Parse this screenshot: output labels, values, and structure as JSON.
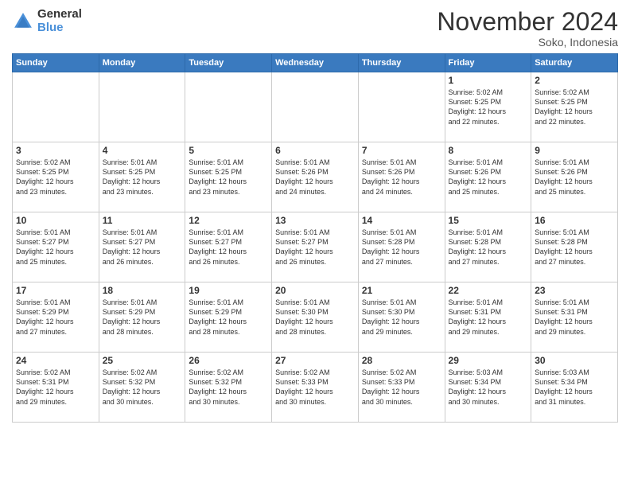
{
  "header": {
    "logo_general": "General",
    "logo_blue": "Blue",
    "month_title": "November 2024",
    "location": "Soko, Indonesia"
  },
  "weekdays": [
    "Sunday",
    "Monday",
    "Tuesday",
    "Wednesday",
    "Thursday",
    "Friday",
    "Saturday"
  ],
  "weeks": [
    [
      {
        "day": "",
        "info": ""
      },
      {
        "day": "",
        "info": ""
      },
      {
        "day": "",
        "info": ""
      },
      {
        "day": "",
        "info": ""
      },
      {
        "day": "",
        "info": ""
      },
      {
        "day": "1",
        "info": "Sunrise: 5:02 AM\nSunset: 5:25 PM\nDaylight: 12 hours\nand 22 minutes."
      },
      {
        "day": "2",
        "info": "Sunrise: 5:02 AM\nSunset: 5:25 PM\nDaylight: 12 hours\nand 22 minutes."
      }
    ],
    [
      {
        "day": "3",
        "info": "Sunrise: 5:02 AM\nSunset: 5:25 PM\nDaylight: 12 hours\nand 23 minutes."
      },
      {
        "day": "4",
        "info": "Sunrise: 5:01 AM\nSunset: 5:25 PM\nDaylight: 12 hours\nand 23 minutes."
      },
      {
        "day": "5",
        "info": "Sunrise: 5:01 AM\nSunset: 5:25 PM\nDaylight: 12 hours\nand 23 minutes."
      },
      {
        "day": "6",
        "info": "Sunrise: 5:01 AM\nSunset: 5:26 PM\nDaylight: 12 hours\nand 24 minutes."
      },
      {
        "day": "7",
        "info": "Sunrise: 5:01 AM\nSunset: 5:26 PM\nDaylight: 12 hours\nand 24 minutes."
      },
      {
        "day": "8",
        "info": "Sunrise: 5:01 AM\nSunset: 5:26 PM\nDaylight: 12 hours\nand 25 minutes."
      },
      {
        "day": "9",
        "info": "Sunrise: 5:01 AM\nSunset: 5:26 PM\nDaylight: 12 hours\nand 25 minutes."
      }
    ],
    [
      {
        "day": "10",
        "info": "Sunrise: 5:01 AM\nSunset: 5:27 PM\nDaylight: 12 hours\nand 25 minutes."
      },
      {
        "day": "11",
        "info": "Sunrise: 5:01 AM\nSunset: 5:27 PM\nDaylight: 12 hours\nand 26 minutes."
      },
      {
        "day": "12",
        "info": "Sunrise: 5:01 AM\nSunset: 5:27 PM\nDaylight: 12 hours\nand 26 minutes."
      },
      {
        "day": "13",
        "info": "Sunrise: 5:01 AM\nSunset: 5:27 PM\nDaylight: 12 hours\nand 26 minutes."
      },
      {
        "day": "14",
        "info": "Sunrise: 5:01 AM\nSunset: 5:28 PM\nDaylight: 12 hours\nand 27 minutes."
      },
      {
        "day": "15",
        "info": "Sunrise: 5:01 AM\nSunset: 5:28 PM\nDaylight: 12 hours\nand 27 minutes."
      },
      {
        "day": "16",
        "info": "Sunrise: 5:01 AM\nSunset: 5:28 PM\nDaylight: 12 hours\nand 27 minutes."
      }
    ],
    [
      {
        "day": "17",
        "info": "Sunrise: 5:01 AM\nSunset: 5:29 PM\nDaylight: 12 hours\nand 27 minutes."
      },
      {
        "day": "18",
        "info": "Sunrise: 5:01 AM\nSunset: 5:29 PM\nDaylight: 12 hours\nand 28 minutes."
      },
      {
        "day": "19",
        "info": "Sunrise: 5:01 AM\nSunset: 5:29 PM\nDaylight: 12 hours\nand 28 minutes."
      },
      {
        "day": "20",
        "info": "Sunrise: 5:01 AM\nSunset: 5:30 PM\nDaylight: 12 hours\nand 28 minutes."
      },
      {
        "day": "21",
        "info": "Sunrise: 5:01 AM\nSunset: 5:30 PM\nDaylight: 12 hours\nand 29 minutes."
      },
      {
        "day": "22",
        "info": "Sunrise: 5:01 AM\nSunset: 5:31 PM\nDaylight: 12 hours\nand 29 minutes."
      },
      {
        "day": "23",
        "info": "Sunrise: 5:01 AM\nSunset: 5:31 PM\nDaylight: 12 hours\nand 29 minutes."
      }
    ],
    [
      {
        "day": "24",
        "info": "Sunrise: 5:02 AM\nSunset: 5:31 PM\nDaylight: 12 hours\nand 29 minutes."
      },
      {
        "day": "25",
        "info": "Sunrise: 5:02 AM\nSunset: 5:32 PM\nDaylight: 12 hours\nand 30 minutes."
      },
      {
        "day": "26",
        "info": "Sunrise: 5:02 AM\nSunset: 5:32 PM\nDaylight: 12 hours\nand 30 minutes."
      },
      {
        "day": "27",
        "info": "Sunrise: 5:02 AM\nSunset: 5:33 PM\nDaylight: 12 hours\nand 30 minutes."
      },
      {
        "day": "28",
        "info": "Sunrise: 5:02 AM\nSunset: 5:33 PM\nDaylight: 12 hours\nand 30 minutes."
      },
      {
        "day": "29",
        "info": "Sunrise: 5:03 AM\nSunset: 5:34 PM\nDaylight: 12 hours\nand 30 minutes."
      },
      {
        "day": "30",
        "info": "Sunrise: 5:03 AM\nSunset: 5:34 PM\nDaylight: 12 hours\nand 31 minutes."
      }
    ]
  ]
}
